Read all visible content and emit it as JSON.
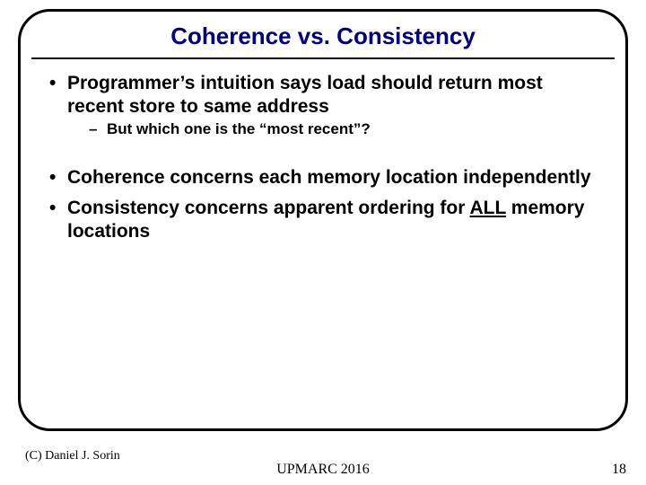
{
  "title": "Coherence vs. Consistency",
  "bullets": {
    "b1": "Programmer’s intuition says load should return most recent store to same address",
    "b1a": "But which one is the “most recent”?",
    "b2": "Coherence concerns each memory location independently",
    "b3_pre": "Consistency concerns apparent ordering for ",
    "b3_u": "ALL",
    "b3_post": " memory locations"
  },
  "footer": {
    "copyright": "(C) Daniel J. Sorin",
    "venue": "UPMARC 2016",
    "page": "18"
  }
}
